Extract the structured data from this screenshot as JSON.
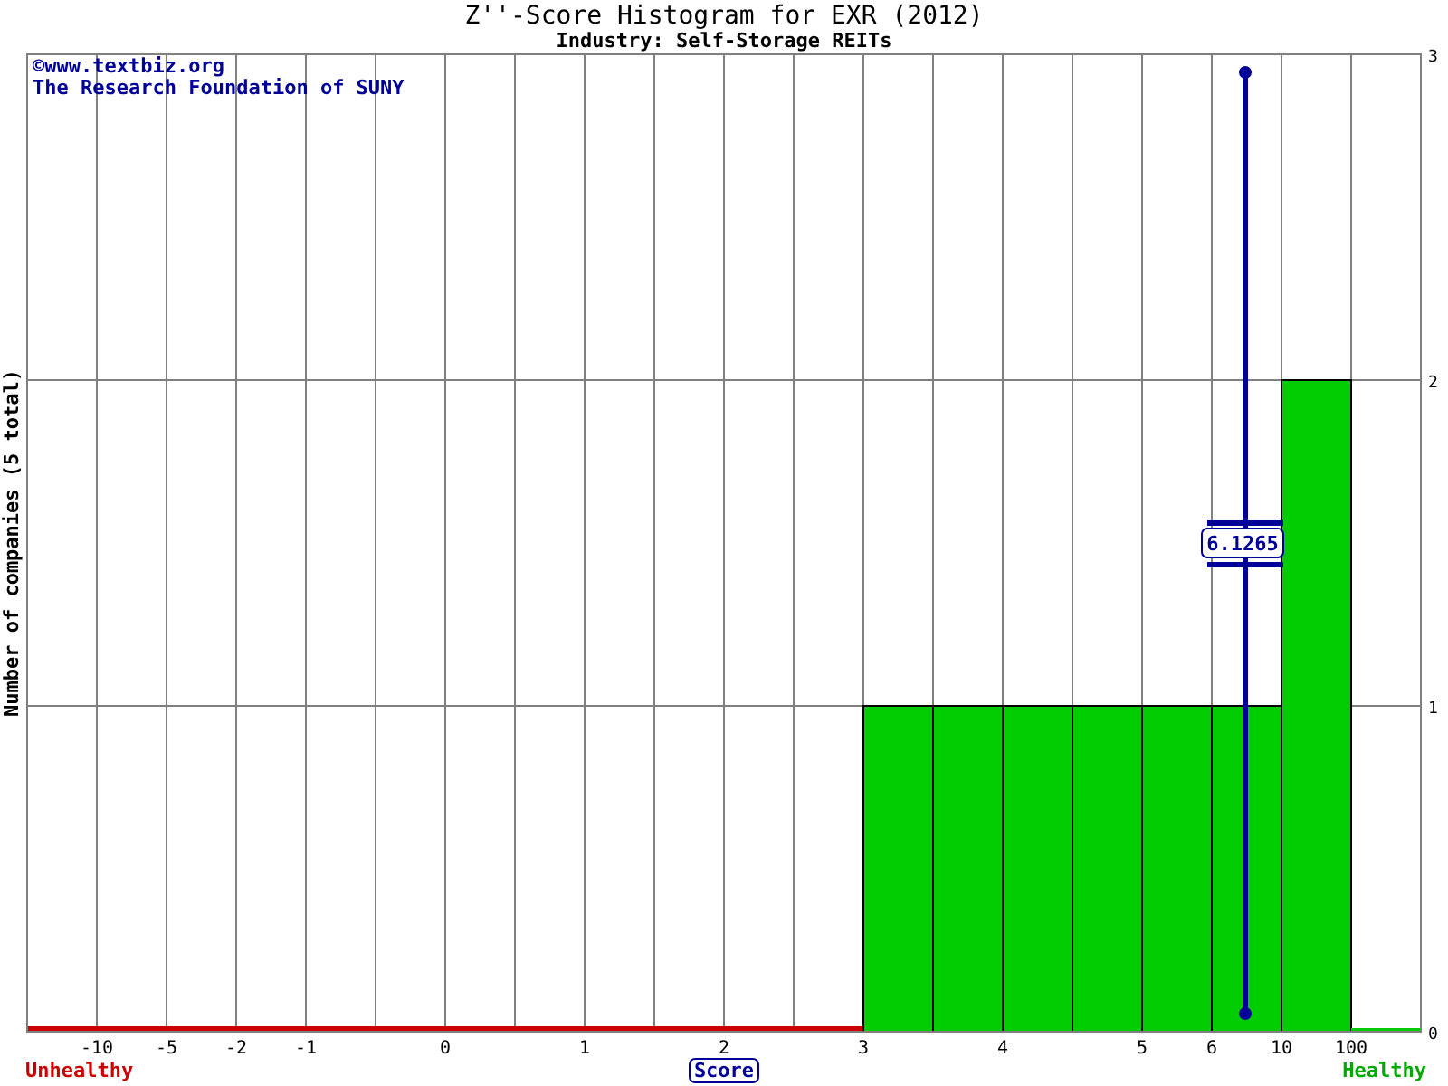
{
  "title": "Z''-Score Histogram for EXR (2012)",
  "subtitle": "Industry: Self-Storage REITs",
  "credits": [
    "©www.textbiz.org",
    "The Research Foundation of SUNY"
  ],
  "x_axis_labels": [
    "-10",
    "-5",
    "-2",
    "-1",
    "0",
    "1",
    "2",
    "3",
    "4",
    "5",
    "6",
    "10",
    "100"
  ],
  "zones": {
    "unhealthy": "Unhealthy",
    "healthy": "Healthy"
  },
  "chart_data": {
    "type": "bar",
    "xlabel": "Score",
    "ylabel": "Number of companies (5 total)",
    "grid": true,
    "categories": [
      null,
      null,
      null,
      null,
      null,
      null,
      null,
      null,
      null,
      null,
      null,
      null,
      null,
      null,
      null,
      null,
      null,
      null,
      null,
      null
    ],
    "series": [
      {
        "color": "#00cc00",
        "values": [
          null,
          null,
          null,
          null,
          null,
          null,
          null,
          null,
          null,
          null,
          null,
          null,
          1,
          1,
          1,
          1,
          1,
          1,
          2,
          0
        ]
      }
    ],
    "ylim": [
      0,
      3
    ],
    "yticks": [
      0,
      1,
      2,
      3
    ],
    "annotations": [
      "6.1265"
    ]
  }
}
